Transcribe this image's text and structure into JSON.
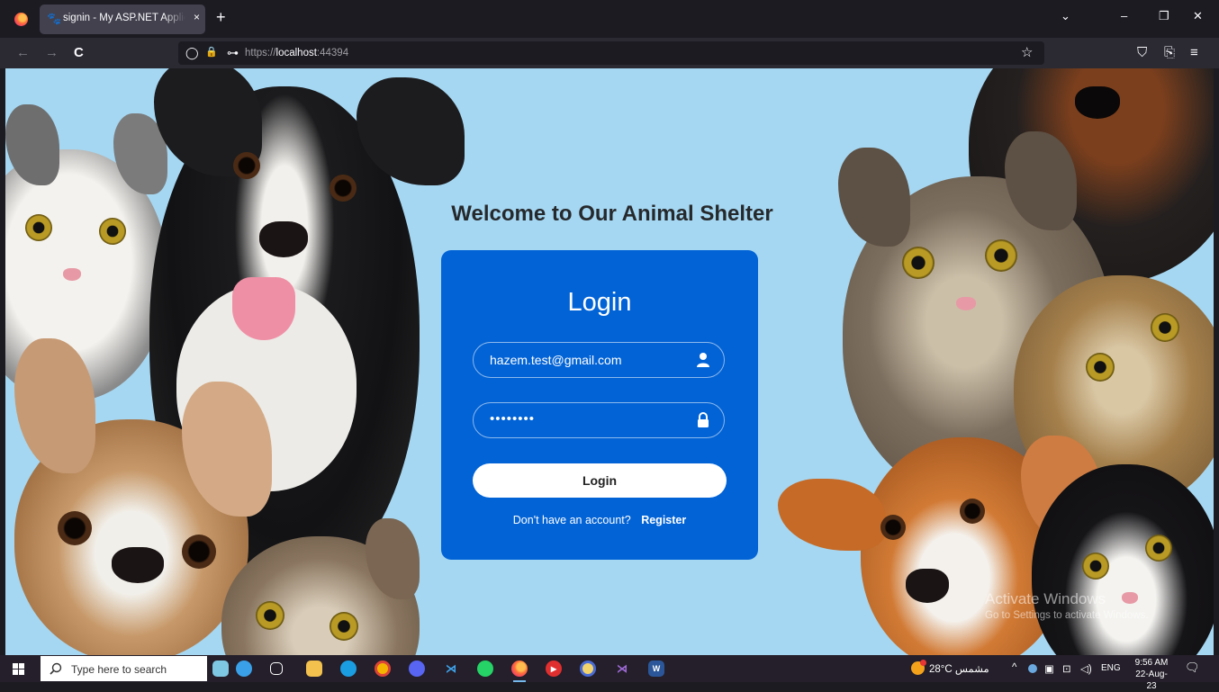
{
  "browser": {
    "tab_title": "signin - My ASP.NET Application",
    "tab_close": "×",
    "new_tab": "+",
    "url_prefix": "https://",
    "url_host": "localhost",
    "url_port": ":44394",
    "icons": {
      "back": "←",
      "forward": "→",
      "reload": "C",
      "shield": "◯",
      "lock": "🔒",
      "key": "⊶",
      "bookmark": "☆",
      "pocket": "⛉",
      "share": "⎘",
      "menu": "≡",
      "tab_list": "⌄",
      "minimize": "–",
      "restore": "❐",
      "close": "✕"
    }
  },
  "page": {
    "welcome": "Welcome to Our Animal Shelter",
    "card": {
      "title": "Login",
      "email_value": "hazem.test@gmail.com",
      "password_value": "••••••••",
      "login_button": "Login",
      "no_account_text": "Don't have an account?",
      "register_link": "Register"
    },
    "background_color": "#a5d7f2",
    "card_color": "#0263d6"
  },
  "watermark": {
    "title": "Activate Windows",
    "subtitle": "Go to Settings to activate Windows."
  },
  "taskbar": {
    "search_placeholder": "Type here to search",
    "weather": "28°C مشمس",
    "language": "ENG",
    "time": "9:56 AM",
    "date": "22-Aug-23",
    "tray_up_arrow": "^",
    "notification_icon": "🗨"
  }
}
